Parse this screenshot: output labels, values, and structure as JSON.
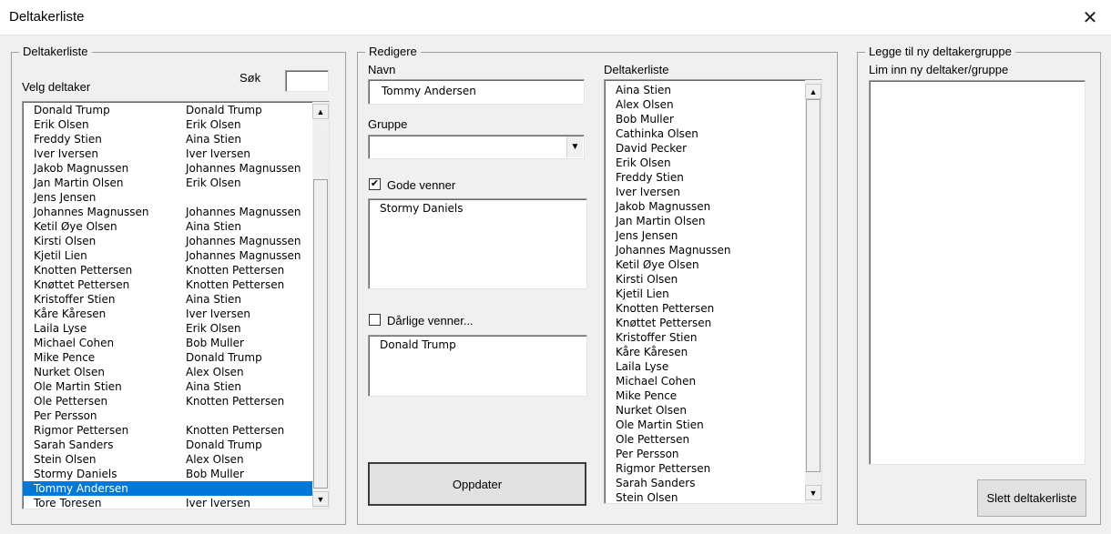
{
  "window": {
    "title": "Deltakerliste",
    "close_icon": "close-icon"
  },
  "left": {
    "legend": "Deltakerliste",
    "search_label": "Søk",
    "search_value": "",
    "select_label": "Velg deltaker",
    "rows": [
      [
        "Donald Trump",
        "Donald Trump"
      ],
      [
        "Erik Olsen",
        "Erik Olsen"
      ],
      [
        "Freddy Stien",
        "Aina Stien"
      ],
      [
        "Iver Iversen",
        "Iver Iversen"
      ],
      [
        "Jakob Magnussen",
        "Johannes Magnussen"
      ],
      [
        "Jan Martin Olsen",
        "Erik Olsen"
      ],
      [
        "Jens Jensen",
        ""
      ],
      [
        "Johannes Magnussen",
        "Johannes Magnussen"
      ],
      [
        "Ketil Øye Olsen",
        "Aina Stien"
      ],
      [
        "Kirsti Olsen",
        "Johannes Magnussen"
      ],
      [
        "Kjetil Lien",
        "Johannes Magnussen"
      ],
      [
        "Knotten Pettersen",
        "Knotten Pettersen"
      ],
      [
        "Knøttet Pettersen",
        "Knotten Pettersen"
      ],
      [
        "Kristoffer Stien",
        "Aina Stien"
      ],
      [
        "Kåre Kåresen",
        "Iver Iversen"
      ],
      [
        "Laila Lyse",
        "Erik Olsen"
      ],
      [
        "Michael Cohen",
        "Bob Muller"
      ],
      [
        "Mike Pence",
        "Donald Trump"
      ],
      [
        "Nurket Olsen",
        "Alex Olsen"
      ],
      [
        "Ole Martin Stien",
        "Aina Stien"
      ],
      [
        "Ole Pettersen",
        "Knotten Pettersen"
      ],
      [
        "Per Persson",
        ""
      ],
      [
        "Rigmor Pettersen",
        "Knotten Pettersen"
      ],
      [
        "Sarah Sanders",
        "Donald Trump"
      ],
      [
        "Stein Olsen",
        "Alex Olsen"
      ],
      [
        "Stormy Daniels",
        "Bob Muller"
      ],
      [
        "Tommy Andersen",
        ""
      ],
      [
        "Tore Toresen",
        "Iver Iversen"
      ]
    ],
    "selected_index": 26
  },
  "middle": {
    "legend": "Redigere",
    "name_label": "Navn",
    "name_value": "Tommy Andersen",
    "group_label": "Gruppe",
    "group_value": "",
    "good_friends_label": "Gode venner",
    "good_friends_checked": true,
    "good_friends": [
      "Stormy Daniels"
    ],
    "bad_friends_label": "Dårlige venner...",
    "bad_friends_checked": false,
    "bad_friends": [
      "Donald Trump"
    ],
    "list_label": "Deltakerliste",
    "list": [
      "Aina Stien",
      "Alex Olsen",
      "Bob Muller",
      "Cathinka Olsen",
      "David Pecker",
      "Erik Olsen",
      "Freddy Stien",
      "Iver Iversen",
      "Jakob Magnussen",
      "Jan Martin Olsen",
      "Jens Jensen",
      "Johannes Magnussen",
      "Ketil Øye Olsen",
      "Kirsti Olsen",
      "Kjetil Lien",
      "Knotten Pettersen",
      "Knøttet Pettersen",
      "Kristoffer Stien",
      "Kåre Kåresen",
      "Laila Lyse",
      "Michael Cohen",
      "Mike Pence",
      "Nurket Olsen",
      "Ole Martin Stien",
      "Ole Pettersen",
      "Per Persson",
      "Rigmor Pettersen",
      "Sarah Sanders",
      "Stein Olsen"
    ],
    "update_button": "Oppdater"
  },
  "right": {
    "legend": "Legge til ny deltakergruppe",
    "paste_label": "Lim inn ny deltaker/gruppe",
    "paste_value": "",
    "delete_button": "Slett deltakerliste"
  }
}
